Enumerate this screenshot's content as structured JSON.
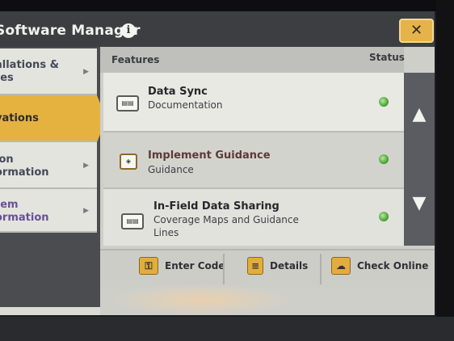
{
  "app": {
    "title": "Software Manager",
    "info_icon": "i",
    "close_label": "✕"
  },
  "sidebar": {
    "items": [
      {
        "label": "allations &\ntes",
        "active": false
      },
      {
        "label": "vations",
        "active": true
      },
      {
        "label": "ion\normation",
        "active": false
      },
      {
        "label": "tem\normation",
        "active": false
      }
    ]
  },
  "panel": {
    "header_features": "Features",
    "header_status": "Status",
    "rows": [
      {
        "title": "Data Sync",
        "subtitle": "Documentation",
        "icon": "data-sync-icon",
        "status_color": "#4ea43a"
      },
      {
        "title": "Implement Guidance",
        "subtitle": "Guidance",
        "icon": "implement-guidance-icon",
        "status_color": "#4ea43a"
      },
      {
        "title": "In-Field Data Sharing",
        "subtitle": "Coverage Maps and Guidance\nLines",
        "icon": "data-sharing-icon",
        "status_color": "#4ea43a"
      }
    ],
    "scroll_up_glyph": "▲",
    "scroll_down_glyph": "▼"
  },
  "bottom_bar": {
    "enter_code": "Enter Code",
    "details": "Details",
    "check_online": "Check Online"
  },
  "colors": {
    "accent": "#e5b240",
    "status_ok": "#4ea43a"
  }
}
